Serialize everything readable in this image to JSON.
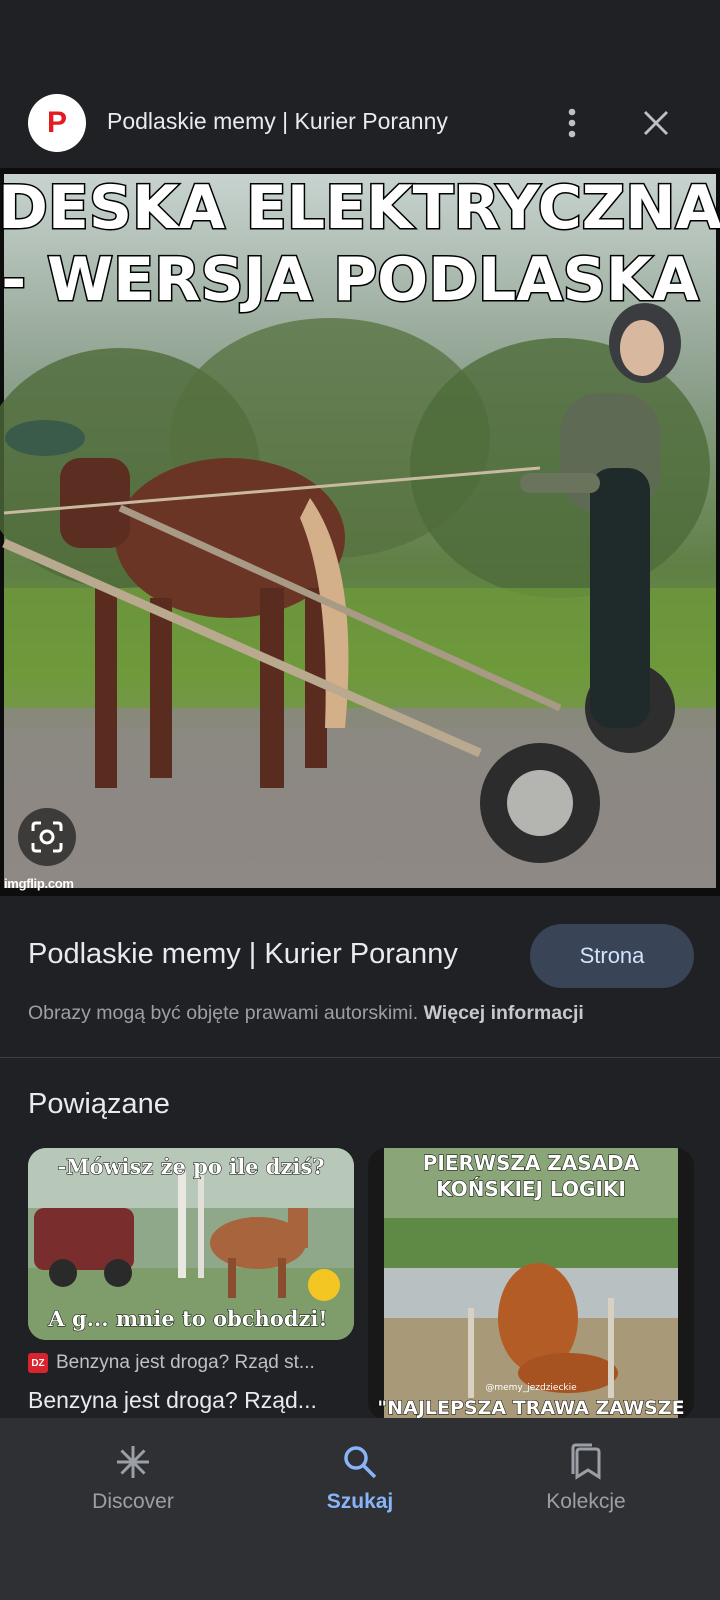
{
  "header": {
    "logo_letter": "P",
    "title": "Podlaskie memy | Kurier Poranny",
    "more_icon": "more-vert-icon",
    "close_icon": "close-icon"
  },
  "main_image": {
    "caption_line1": "DESKA ELEKTRYCZNA",
    "caption_line2": "- WERSJA PODLASKA",
    "watermark": "imgflip.com",
    "lens_icon": "lens-icon"
  },
  "info": {
    "title": "Podlaskie memy | Kurier Poranny",
    "visit_label": "Strona",
    "copyright_text": "Obrazy mogą być objęte prawami autorskimi.",
    "more_info_label": "Więcej informacji"
  },
  "related": {
    "heading": "Powiązane",
    "cards": [
      {
        "top_text": "-Mówisz że po ile dziś?",
        "bottom_text": "A g... mnie to obchodzi!",
        "favicon_text": "DZ",
        "source": "Benzyna jest droga? Rząd st...",
        "title": "Benzyna jest droga? Rząd..."
      },
      {
        "top_text_1": "PIERWSZA ZASADA",
        "top_text_2": "KOŃSKIEJ LOGIKI",
        "credit": "@memy_jezdzieckie",
        "bottom_text": "\"NAJLEPSZA TRAWA ZAWSZE"
      }
    ]
  },
  "nav": {
    "items": [
      {
        "label": "Discover",
        "icon": "asterisk-icon",
        "active": false
      },
      {
        "label": "Szukaj",
        "icon": "search-icon",
        "active": true
      },
      {
        "label": "Kolekcje",
        "icon": "bookmarks-icon",
        "active": false
      }
    ]
  },
  "colors": {
    "background": "#202124",
    "accent": "#8ab4f8",
    "button_bg": "#394457",
    "logo_red": "#e31b23"
  }
}
